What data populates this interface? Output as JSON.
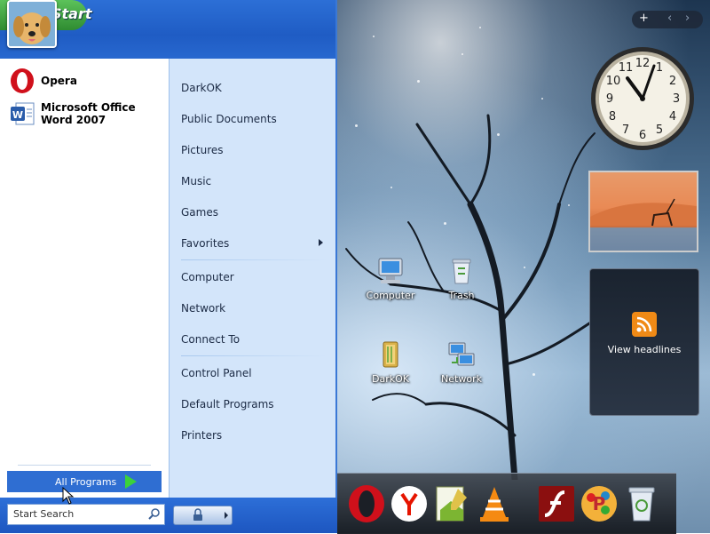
{
  "start_menu": {
    "start_label": "Start",
    "pinned": [
      {
        "label": "Opera"
      },
      {
        "label": "Microsoft Office Word 2007"
      }
    ],
    "places": [
      {
        "label": "DarkOK"
      },
      {
        "label": "Public Documents"
      },
      {
        "label": "Pictures"
      },
      {
        "label": "Music"
      },
      {
        "label": "Games"
      },
      {
        "label": "Favorites"
      },
      {
        "label": "Computer"
      },
      {
        "label": "Network"
      },
      {
        "label": "Connect To"
      },
      {
        "label": "Control Panel"
      },
      {
        "label": "Default Programs"
      },
      {
        "label": "Printers"
      }
    ],
    "all_programs_label": "All Programs",
    "search_placeholder": "Start Search"
  },
  "desktop_icons": [
    {
      "label": "Computer",
      "icon": "computer-icon"
    },
    {
      "label": "Trash",
      "icon": "trash-icon"
    },
    {
      "label": "DarkOK",
      "icon": "folder-icon"
    },
    {
      "label": "Network",
      "icon": "network-icon"
    }
  ],
  "gadgets": {
    "toolbar_add": "+",
    "clock_numbers": [
      "12",
      "1",
      "2",
      "3",
      "4",
      "5",
      "6",
      "7",
      "8",
      "9",
      "10",
      "11"
    ],
    "rss_label": "View headlines"
  },
  "dock_icons": [
    "opera-icon",
    "yandex-icon",
    "notepad-icon",
    "vlc-icon",
    "flash-icon",
    "paint-icon",
    "recycle-bin-icon"
  ],
  "colors": {
    "start_blue": "#1f5cc4",
    "right_pane": "#d3e5fa",
    "start_green": "#2f8c31"
  }
}
